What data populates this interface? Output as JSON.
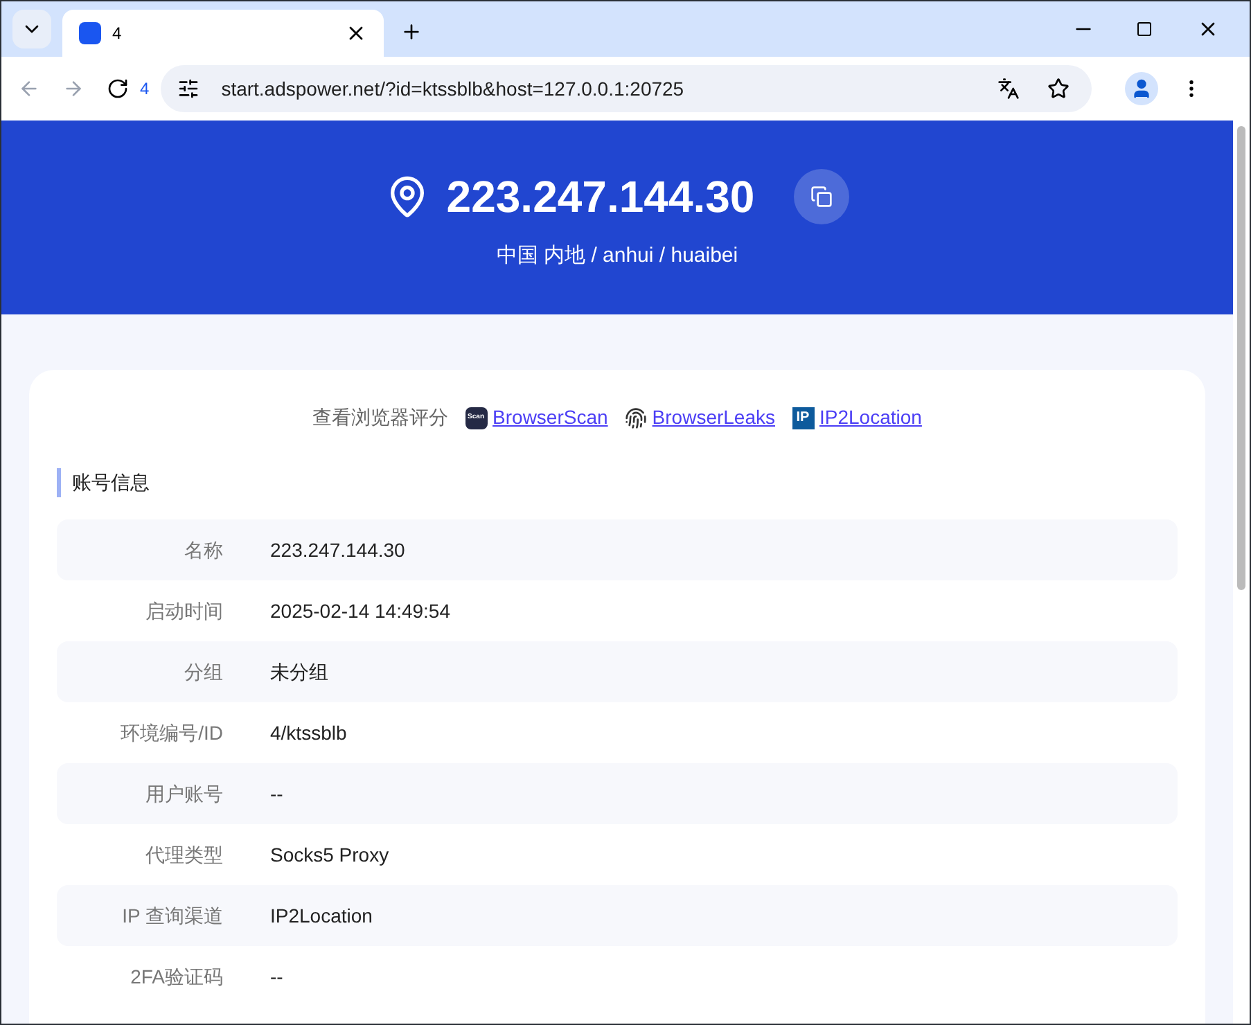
{
  "browser": {
    "tab_title": "4",
    "tab_count": "4",
    "url": "start.adspower.net/?id=ktssblb&host=127.0.0.1:20725"
  },
  "header": {
    "ip": "223.247.144.30",
    "location": "中国 内地 / anhui / huaibei"
  },
  "score_links": {
    "label": "查看浏览器评分",
    "links": [
      {
        "kind": "scan",
        "logo_text": "Scan",
        "text": "BrowserScan"
      },
      {
        "kind": "fingerprint",
        "text": "BrowserLeaks"
      },
      {
        "kind": "ip",
        "logo_text": "IP",
        "text": "IP2Location"
      }
    ]
  },
  "section_title": "账号信息",
  "rows": [
    {
      "label": "名称",
      "value": "223.247.144.30"
    },
    {
      "label": "启动时间",
      "value": "2025-02-14 14:49:54"
    },
    {
      "label": "分组",
      "value": "未分组"
    },
    {
      "label": "环境编号/ID",
      "value": "4/ktssblb"
    },
    {
      "label": "用户账号",
      "value": "--"
    },
    {
      "label": "代理类型",
      "value": "Socks5 Proxy"
    },
    {
      "label": "IP 查询渠道",
      "value": "IP2Location"
    },
    {
      "label": "2FA验证码",
      "value": "--"
    }
  ]
}
